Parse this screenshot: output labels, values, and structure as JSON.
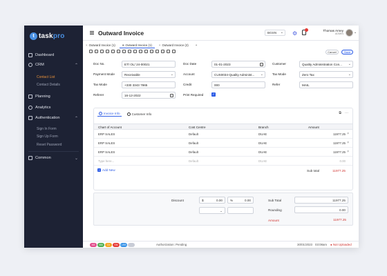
{
  "brand": {
    "logo_letter": "t",
    "name_a": "task",
    "name_b": "pro",
    "accent": "#4a90e2"
  },
  "sidebar": {
    "items": [
      {
        "label": "Dashboard",
        "icon": "grid-icon"
      },
      {
        "label": "CRM",
        "icon": "user-icon"
      },
      {
        "label": "Planning",
        "icon": "calendar-icon"
      },
      {
        "label": "Analytics",
        "icon": "chart-icon"
      },
      {
        "label": "Authentication",
        "icon": "lock-icon"
      },
      {
        "label": "Common",
        "icon": "stack-icon"
      }
    ],
    "crm_sub": [
      "Contact List",
      "Contact Details"
    ],
    "auth_sub": [
      "Sign In Form",
      "Sign Up Form",
      "Reset Password"
    ]
  },
  "header": {
    "title": "Outward Invoice",
    "language": "BGSN",
    "user_name": "Thomas Arney",
    "user_role": "ADMIN"
  },
  "tabs": [
    "Outward Invoice (1)",
    "Outward Invoice (1)",
    "Outward Invoice (2)",
    "+"
  ],
  "actions": {
    "cancel": "Cancel",
    "save": "Save"
  },
  "form": {
    "doc_no_label": "Doc No.",
    "doc_no": "ET/ OL/ 24-00021",
    "doc_date_label": "Doc Date",
    "doc_date": "01-01-2023",
    "customer_label": "Customer",
    "customer": "Quality Administration Con...",
    "payment_mode_label": "Payment Mode",
    "payment_mode": "Receivable",
    "account_label": "Account",
    "account": "CUS0034-Quality Administ...",
    "tax_mode_label": "Tax Mode",
    "tax_mode": "Zero Tax",
    "tax_mode2_label": "Tax Mode",
    "tax_mode2": "+330 3343 7865",
    "credit_label": "Credit",
    "credit": "000",
    "refer_label": "Refer",
    "refer": "MAIL",
    "referer_label": "Referer",
    "referer": "16-12-2022",
    "print_label": "Print Required",
    "print_checked": true
  },
  "card": {
    "tab1": "Invoice Info",
    "tab2": "Customer Info",
    "columns": [
      "Chart of Account",
      "Cost Centre",
      "Branch",
      "Amount"
    ],
    "rows": [
      {
        "account": "ERP SALES",
        "centre": "Default",
        "branch": "DUAE",
        "amount": "11977.25"
      },
      {
        "account": "ERP SALES",
        "centre": "Default",
        "branch": "DUAE",
        "amount": "11977.25"
      },
      {
        "account": "ERP SALES",
        "centre": "Default",
        "branch": "DUAE",
        "amount": "11977.25"
      }
    ],
    "placeholder": {
      "account": "Type here...",
      "centre": "Default",
      "branch": "DUAE",
      "amount": "0.00"
    },
    "add_new": "Add New",
    "sub_total_label": "Sub total",
    "sub_total": "11977.25"
  },
  "totals": {
    "discount_label": "Discount",
    "currency": "$",
    "discount": "0.00",
    "percent": "%",
    "percent_value": "0.00",
    "subtotal_label": "Sub Total",
    "subtotal": "11977.25",
    "rounding_label": "Rounding",
    "rounding": "0.00",
    "amount_label": "Amount",
    "amount": "11977.25"
  },
  "status": {
    "pills": [
      {
        "t": "M3",
        "c": "#e24a8a"
      },
      {
        "t": "080",
        "c": "#4caf50"
      },
      {
        "t": "DI",
        "c": "#f5a623"
      },
      {
        "t": "SM",
        "c": "#e53935"
      },
      {
        "t": "USB",
        "c": "#2f8ee6"
      },
      {
        "t": "",
        "c": "#c8ccd6"
      }
    ],
    "mode": "Authorization: Pending",
    "date": "30/01/2023",
    "time": "03:08am",
    "unsaved": "● Not Uploaded"
  },
  "colors": {
    "primary": "#2f5ee6",
    "danger": "#d0312d",
    "sidebar": "#1d2234",
    "active_sub": "#e8913a"
  }
}
